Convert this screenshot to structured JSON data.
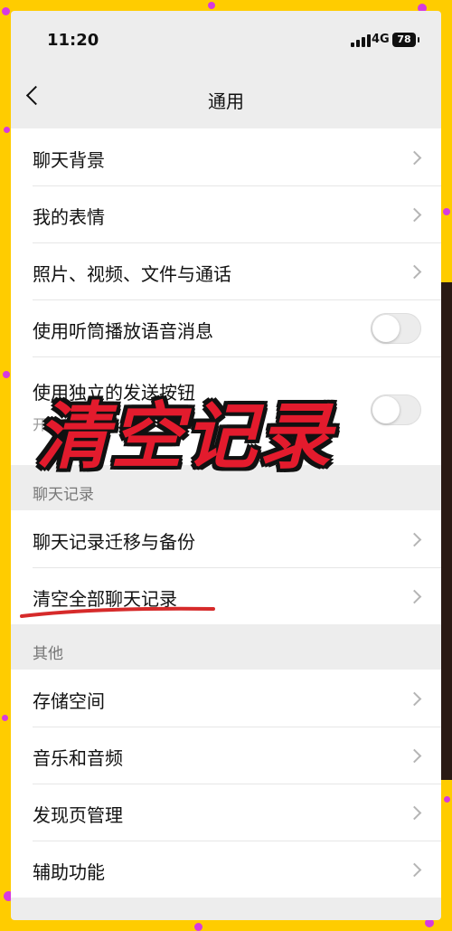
{
  "status_bar": {
    "time": "11:20",
    "network": "4G",
    "battery": "78"
  },
  "nav": {
    "title": "通用"
  },
  "group1": [
    {
      "label": "聊天背景"
    },
    {
      "label": "我的表情"
    },
    {
      "label": "照片、视频、文件与通话"
    },
    {
      "label": "使用听筒播放语音消息",
      "toggle": false
    },
    {
      "label": "使用独立的发送按钮",
      "sub": "开启后…换行",
      "toggle": false
    }
  ],
  "section_chat": {
    "title": "聊天记录"
  },
  "chat_items": [
    {
      "label": "聊天记录迁移与备份"
    },
    {
      "label": "清空全部聊天记录"
    }
  ],
  "section_other": {
    "title": "其他"
  },
  "other_items": [
    {
      "label": "存储空间"
    },
    {
      "label": "音乐和音频"
    },
    {
      "label": "发现页管理"
    },
    {
      "label": "辅助功能"
    }
  ],
  "overlay": {
    "caption": "清空记录"
  },
  "colors": {
    "frame": "#ffcc00",
    "dots": "#d63adf",
    "caption": "#e31b2d",
    "underline": "#d62a2a"
  }
}
